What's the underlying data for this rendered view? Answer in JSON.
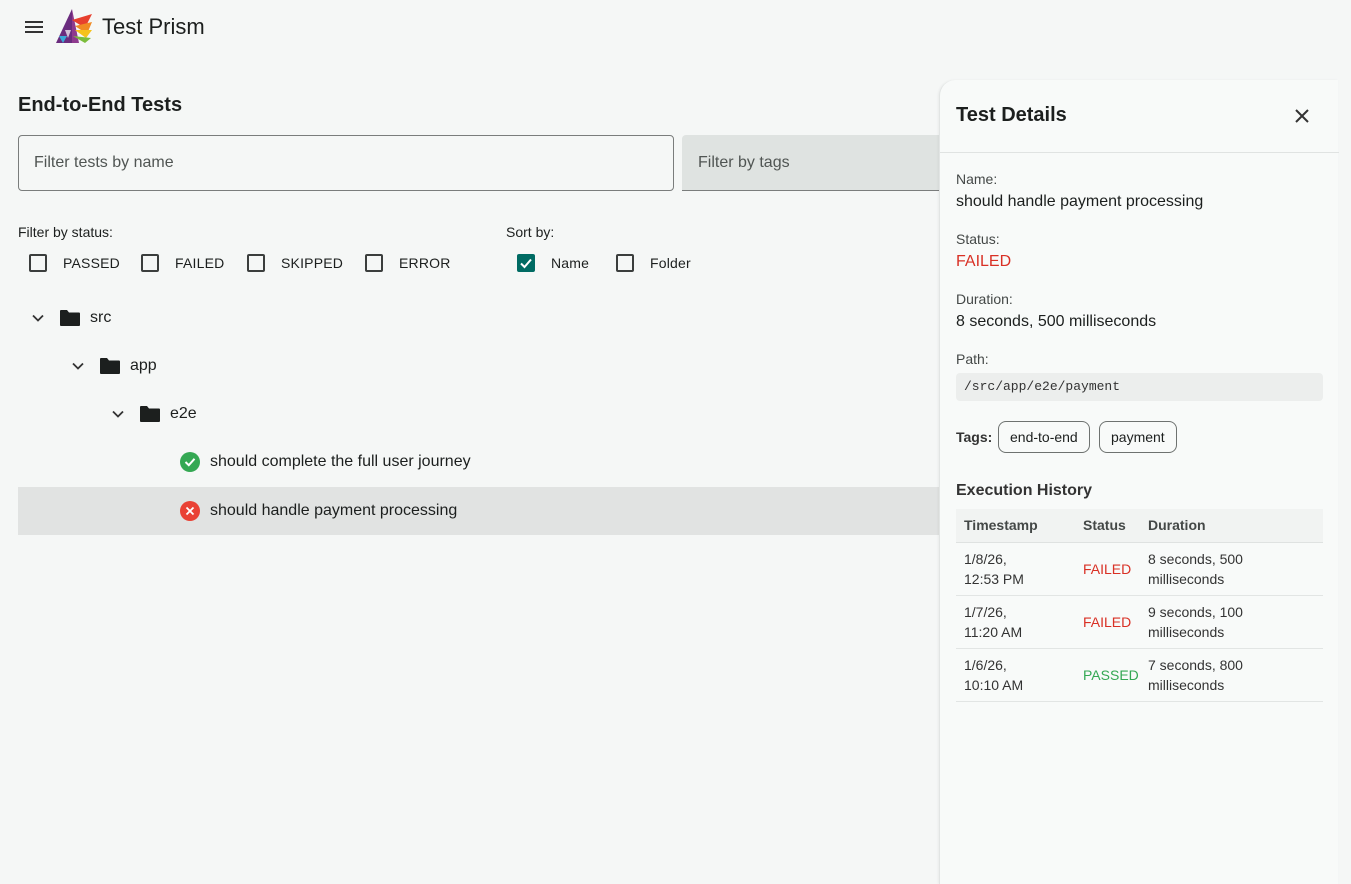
{
  "app": {
    "title": "Test Prism"
  },
  "page": {
    "title": "End-to-End Tests"
  },
  "filters": {
    "name_placeholder": "Filter tests by name",
    "tags_placeholder": "Filter by tags",
    "status_label": "Filter by status:",
    "status_options": [
      {
        "label": "PASSED",
        "checked": false
      },
      {
        "label": "FAILED",
        "checked": false
      },
      {
        "label": "SKIPPED",
        "checked": false
      },
      {
        "label": "ERROR",
        "checked": false
      }
    ],
    "sort_label": "Sort by:",
    "sort_options": [
      {
        "label": "Name",
        "checked": true
      },
      {
        "label": "Folder",
        "checked": false
      }
    ]
  },
  "tree": [
    {
      "type": "folder",
      "label": "src",
      "expanded": true
    },
    {
      "type": "folder",
      "label": "app",
      "expanded": true
    },
    {
      "type": "folder",
      "label": "e2e",
      "expanded": true
    },
    {
      "type": "test",
      "label": "should complete the full user journey",
      "status": "passed"
    },
    {
      "type": "test",
      "label": "should handle payment processing",
      "status": "failed",
      "selected": true
    }
  ],
  "details": {
    "title": "Test Details",
    "name_label": "Name:",
    "name": "should handle payment processing",
    "status_label": "Status:",
    "status": "FAILED",
    "duration_label": "Duration:",
    "duration": "8 seconds, 500 milliseconds",
    "path_label": "Path:",
    "path": "/src/app/e2e/payment",
    "tags_label": "Tags:",
    "tags": [
      "end-to-end",
      "payment"
    ],
    "history_title": "Execution History",
    "history_headers": [
      "Timestamp",
      "Status",
      "Duration"
    ],
    "history": [
      {
        "timestamp_date": "1/8/26,",
        "timestamp_time": "12:53 PM",
        "status": "FAILED",
        "duration_line1": "8 seconds, 500",
        "duration_line2": "milliseconds"
      },
      {
        "timestamp_date": "1/7/26,",
        "timestamp_time": "11:20 AM",
        "status": "FAILED",
        "duration_line1": "9 seconds, 100",
        "duration_line2": "milliseconds"
      },
      {
        "timestamp_date": "1/6/26,",
        "timestamp_time": "10:10 AM",
        "status": "PASSED",
        "duration_line1": "7 seconds, 800",
        "duration_line2": "milliseconds"
      }
    ]
  },
  "colors": {
    "accent": "#006b63",
    "failed": "#d93025",
    "passed": "#34a853"
  }
}
